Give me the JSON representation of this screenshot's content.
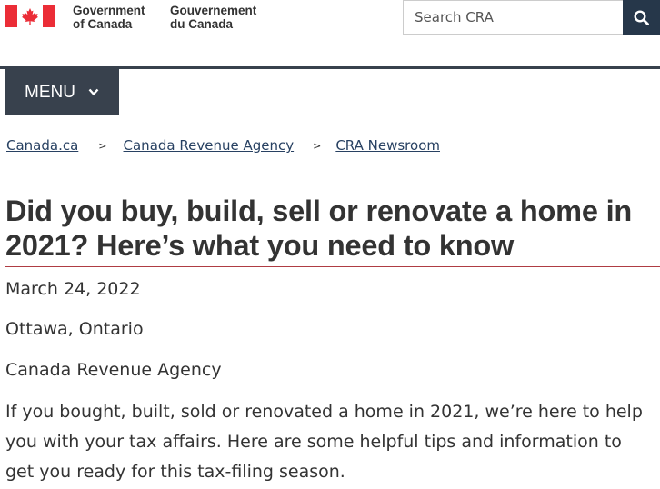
{
  "header": {
    "signature_en_line1": "Government",
    "signature_en_line2": "of Canada",
    "signature_fr_line1": "Gouvernement",
    "signature_fr_line2": "du Canada",
    "search_placeholder": "Search CRA",
    "search_icon": "search-icon",
    "flag_icon": "canada-flag-icon",
    "accent_color": "#26374a",
    "flag_color": "#eb2d37"
  },
  "menu": {
    "label": "MENU",
    "icon": "chevron-down-icon",
    "color": "#38414d"
  },
  "breadcrumb": [
    {
      "label": "Canada.ca"
    },
    {
      "label": "Canada Revenue Agency"
    },
    {
      "label": "CRA Newsroom"
    }
  ],
  "breadcrumb_separator": ">",
  "article": {
    "title": "Did you buy, build, sell or renovate a home in 2021? Here’s what you need to know",
    "date": "March 24, 2022",
    "location": "Ottawa, Ontario",
    "organization": "Canada Revenue Agency",
    "intro": "If you bought, built, sold or renovated a home in 2021, we’re here to help you with your tax affairs. Here are some helpful tips and information to get you ready for this tax-filing season.",
    "title_rule_color": "#af3c43"
  }
}
